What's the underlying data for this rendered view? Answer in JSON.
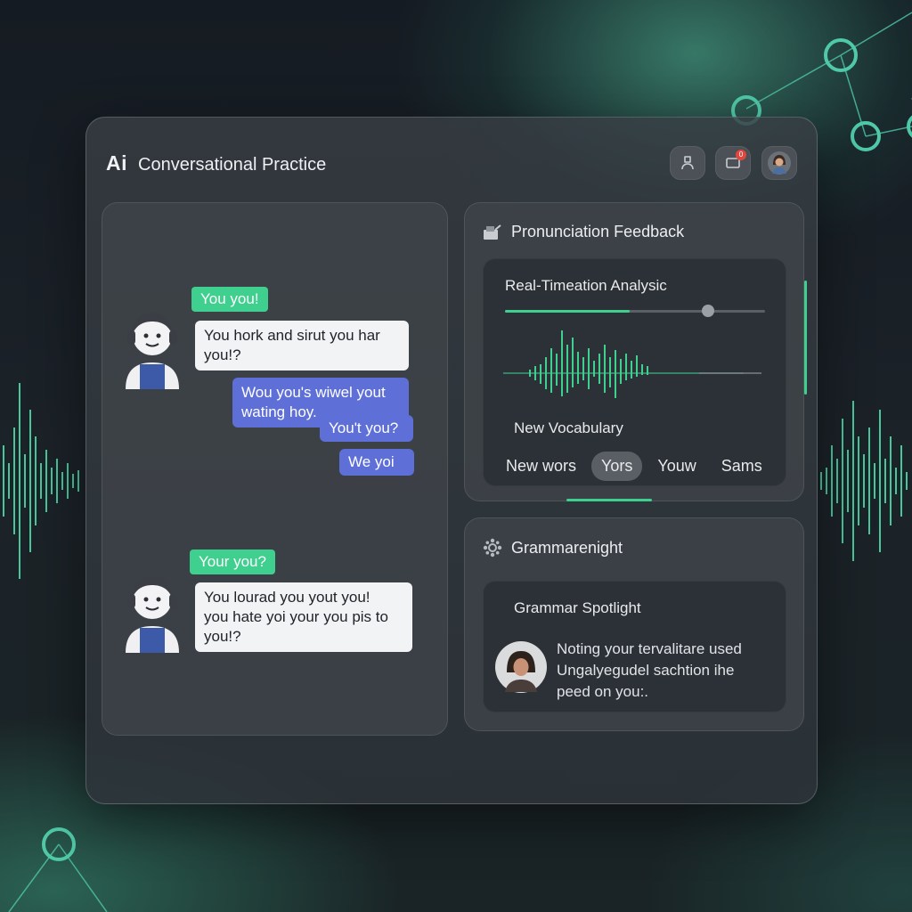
{
  "header": {
    "logo": "Ai",
    "title": "Conversational Practice",
    "buttons": [
      {
        "icon": "person-icon"
      },
      {
        "icon": "message-icon",
        "badge": "0"
      },
      {
        "icon": "user-avatar"
      }
    ]
  },
  "chat": {
    "messages": [
      {
        "sender": "ai",
        "tag": "You you!",
        "text_line1": "You hork and sirut you har",
        "text_line2": "you!?"
      },
      {
        "sender": "user",
        "line1": "Wou you's wiwel yout",
        "line2": "wating hoy.",
        "line3": "You't you?",
        "line4": "We yoi"
      },
      {
        "sender": "ai",
        "tag": "Your you?",
        "text_line1": "You lourad you yout you!",
        "text_line2": "you hate yoi your you pis to",
        "text_line3": "you!?"
      }
    ]
  },
  "pronunciation": {
    "title": "Pronunciation Feedback",
    "analysis_title": "Real-Timeation Analysic",
    "progress": 0.48,
    "vocab_title": "New Vocabulary",
    "chips": [
      "New wors",
      "Yors",
      "Youw",
      "Sams"
    ],
    "active_chip": 1
  },
  "grammar": {
    "title": "Grammarenight",
    "spotlight_title": "Grammar Spotlight",
    "line1": "Noting your tervalitare used",
    "line2": "Ungalyegudel sachtion ihe",
    "line3": "peed on you:."
  },
  "colors": {
    "accent": "#3fcf8e",
    "user_bubble": "#5e6fd8",
    "panel": "#3e4349",
    "background": "#151b22",
    "notification": "#e0473f"
  }
}
